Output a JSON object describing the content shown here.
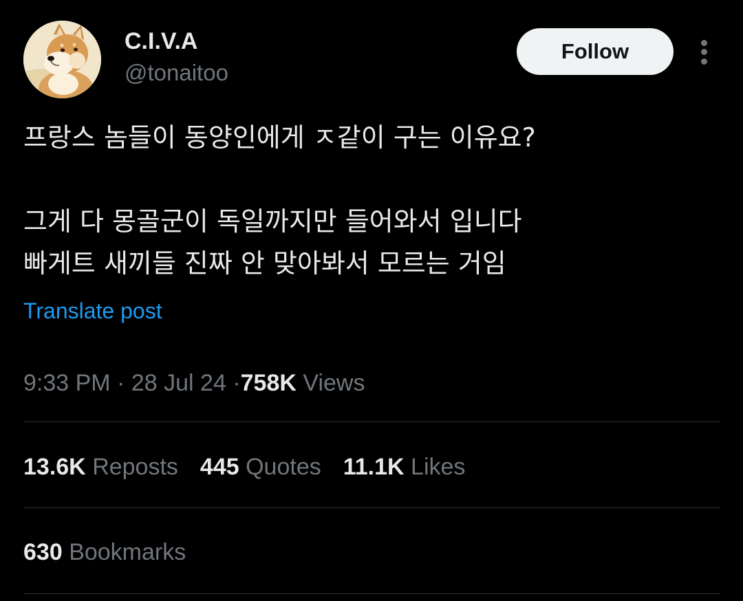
{
  "author": {
    "display_name": "C.I.V.A",
    "handle": "@tonaitoo",
    "avatar_icon": "shiba-inu-dog-avatar"
  },
  "actions": {
    "follow_label": "Follow",
    "more_icon": "more-vertical-icon"
  },
  "tweet": {
    "lines": [
      "프랑스 놈들이 동양인에게 ㅈ같이 구는 이유요?",
      "",
      "그게 다 몽골군이 독일까지만 들어와서 입니다",
      "빠게트 새끼들 진짜 안 맞아봐서 모르는 거임"
    ],
    "translate_label": "Translate post"
  },
  "meta": {
    "time": "9:33 PM",
    "separator": "·",
    "date": "28 Jul 24",
    "views_count": "758K",
    "views_label": "Views"
  },
  "stats": {
    "reposts_count": "13.6K",
    "reposts_label": "Reposts",
    "quotes_count": "445",
    "quotes_label": "Quotes",
    "likes_count": "11.1K",
    "likes_label": "Likes",
    "bookmarks_count": "630",
    "bookmarks_label": "Bookmarks"
  },
  "colors": {
    "background": "#000000",
    "text_primary": "#e7e9ea",
    "text_secondary": "#71767b",
    "link": "#1d9bf0",
    "divider": "#2f3336",
    "follow_bg": "#eff3f4"
  }
}
